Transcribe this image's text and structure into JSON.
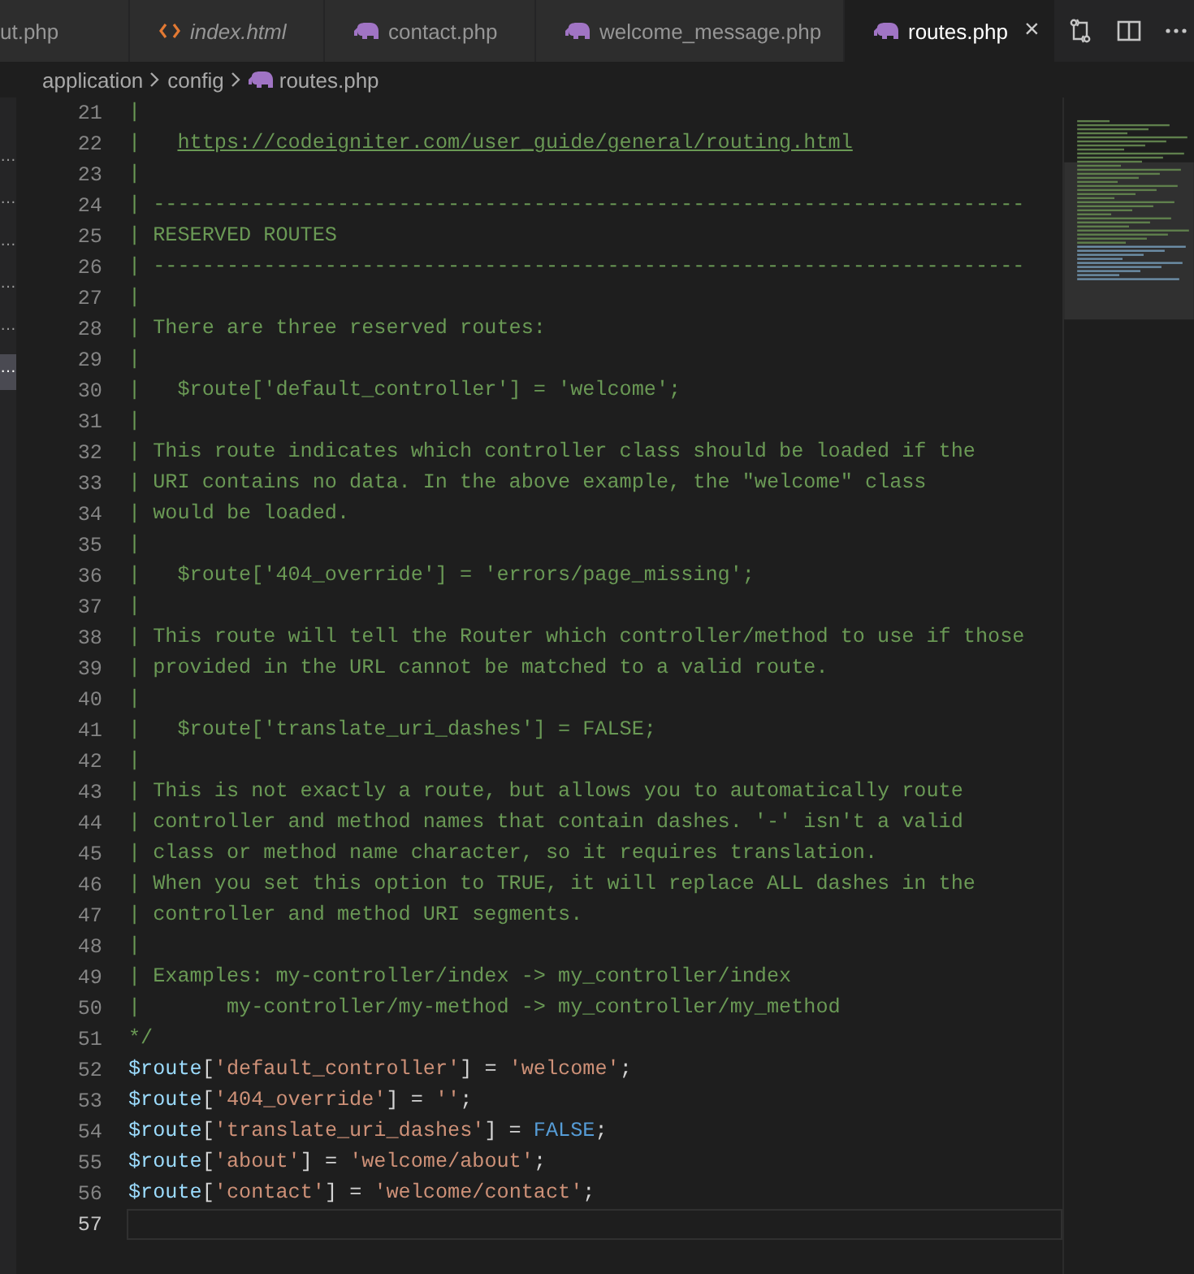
{
  "tabs": [
    {
      "label": "ut.php",
      "kind": "plain",
      "italic": false,
      "selected": false
    },
    {
      "label": "index.html",
      "kind": "html",
      "italic": true,
      "selected": false
    },
    {
      "label": "contact.php",
      "kind": "php",
      "italic": false,
      "selected": false
    },
    {
      "label": "welcome_message.php",
      "kind": "php",
      "italic": false,
      "selected": false
    },
    {
      "label": "routes.php",
      "kind": "php",
      "italic": false,
      "selected": true
    }
  ],
  "close_glyph": "×",
  "breadcrumb": [
    {
      "label": "application",
      "kind": "folder"
    },
    {
      "label": "config",
      "kind": "folder"
    },
    {
      "label": "routes.php",
      "kind": "php"
    }
  ],
  "sidebar_fragments": [
    {
      "text": "…",
      "selected": false
    },
    {
      "text": "…",
      "selected": false
    },
    {
      "text": "…",
      "selected": false
    },
    {
      "text": "…",
      "selected": false
    },
    {
      "text": "…",
      "selected": false
    },
    {
      "text": "…",
      "selected": true
    }
  ],
  "lines": [
    {
      "number": "21",
      "current": false,
      "tokens": [
        {
          "kind": "comment",
          "text": "|"
        }
      ]
    },
    {
      "number": "22",
      "current": false,
      "tokens": [
        {
          "kind": "comment",
          "text": "|   "
        },
        {
          "kind": "link",
          "text": "https://codeigniter.com/user_guide/general/routing.html"
        }
      ]
    },
    {
      "number": "23",
      "current": false,
      "tokens": [
        {
          "kind": "comment",
          "text": "|"
        }
      ]
    },
    {
      "number": "24",
      "current": false,
      "tokens": [
        {
          "kind": "comment",
          "text": "| -----------------------------------------------------------------------"
        }
      ]
    },
    {
      "number": "25",
      "current": false,
      "tokens": [
        {
          "kind": "comment",
          "text": "| RESERVED ROUTES"
        }
      ]
    },
    {
      "number": "26",
      "current": false,
      "tokens": [
        {
          "kind": "comment",
          "text": "| -----------------------------------------------------------------------"
        }
      ]
    },
    {
      "number": "27",
      "current": false,
      "tokens": [
        {
          "kind": "comment",
          "text": "|"
        }
      ]
    },
    {
      "number": "28",
      "current": false,
      "tokens": [
        {
          "kind": "comment",
          "text": "| There are three reserved routes:"
        }
      ]
    },
    {
      "number": "29",
      "current": false,
      "tokens": [
        {
          "kind": "comment",
          "text": "|"
        }
      ]
    },
    {
      "number": "30",
      "current": false,
      "tokens": [
        {
          "kind": "comment",
          "text": "|   $route['default_controller'] = 'welcome';"
        }
      ]
    },
    {
      "number": "31",
      "current": false,
      "tokens": [
        {
          "kind": "comment",
          "text": "|"
        }
      ]
    },
    {
      "number": "32",
      "current": false,
      "tokens": [
        {
          "kind": "comment",
          "text": "| This route indicates which controller class should be loaded if the"
        }
      ]
    },
    {
      "number": "33",
      "current": false,
      "tokens": [
        {
          "kind": "comment",
          "text": "| URI contains no data. In the above example, the \"welcome\" class"
        }
      ]
    },
    {
      "number": "34",
      "current": false,
      "tokens": [
        {
          "kind": "comment",
          "text": "| would be loaded."
        }
      ]
    },
    {
      "number": "35",
      "current": false,
      "tokens": [
        {
          "kind": "comment",
          "text": "|"
        }
      ]
    },
    {
      "number": "36",
      "current": false,
      "tokens": [
        {
          "kind": "comment",
          "text": "|   $route['404_override'] = 'errors/page_missing';"
        }
      ]
    },
    {
      "number": "37",
      "current": false,
      "tokens": [
        {
          "kind": "comment",
          "text": "|"
        }
      ]
    },
    {
      "number": "38",
      "current": false,
      "tokens": [
        {
          "kind": "comment",
          "text": "| This route will tell the Router which controller/method to use if those"
        }
      ]
    },
    {
      "number": "39",
      "current": false,
      "tokens": [
        {
          "kind": "comment",
          "text": "| provided in the URL cannot be matched to a valid route."
        }
      ]
    },
    {
      "number": "40",
      "current": false,
      "tokens": [
        {
          "kind": "comment",
          "text": "|"
        }
      ]
    },
    {
      "number": "41",
      "current": false,
      "tokens": [
        {
          "kind": "comment",
          "text": "|   $route['translate_uri_dashes'] = FALSE;"
        }
      ]
    },
    {
      "number": "42",
      "current": false,
      "tokens": [
        {
          "kind": "comment",
          "text": "|"
        }
      ]
    },
    {
      "number": "43",
      "current": false,
      "tokens": [
        {
          "kind": "comment",
          "text": "| This is not exactly a route, but allows you to automatically route"
        }
      ]
    },
    {
      "number": "44",
      "current": false,
      "tokens": [
        {
          "kind": "comment",
          "text": "| controller and method names that contain dashes. '-' isn't a valid"
        }
      ]
    },
    {
      "number": "45",
      "current": false,
      "tokens": [
        {
          "kind": "comment",
          "text": "| class or method name character, so it requires translation."
        }
      ]
    },
    {
      "number": "46",
      "current": false,
      "tokens": [
        {
          "kind": "comment",
          "text": "| When you set this option to TRUE, it will replace ALL dashes in the"
        }
      ]
    },
    {
      "number": "47",
      "current": false,
      "tokens": [
        {
          "kind": "comment",
          "text": "| controller and method URI segments."
        }
      ]
    },
    {
      "number": "48",
      "current": false,
      "tokens": [
        {
          "kind": "comment",
          "text": "|"
        }
      ]
    },
    {
      "number": "49",
      "current": false,
      "tokens": [
        {
          "kind": "comment",
          "text": "| Examples: my-controller/index -> my_controller/index"
        }
      ]
    },
    {
      "number": "50",
      "current": false,
      "tokens": [
        {
          "kind": "comment",
          "text": "|       my-controller/my-method -> my_controller/my_method"
        }
      ]
    },
    {
      "number": "51",
      "current": false,
      "tokens": [
        {
          "kind": "comment",
          "text": "*/"
        }
      ]
    },
    {
      "number": "52",
      "current": false,
      "tokens": [
        {
          "kind": "variable",
          "text": "$route"
        },
        {
          "kind": "punct",
          "text": "["
        },
        {
          "kind": "string",
          "text": "'default_controller'"
        },
        {
          "kind": "punct",
          "text": "] = "
        },
        {
          "kind": "string",
          "text": "'welcome'"
        },
        {
          "kind": "punct",
          "text": ";"
        }
      ]
    },
    {
      "number": "53",
      "current": false,
      "tokens": [
        {
          "kind": "variable",
          "text": "$route"
        },
        {
          "kind": "punct",
          "text": "["
        },
        {
          "kind": "string",
          "text": "'404_override'"
        },
        {
          "kind": "punct",
          "text": "] = "
        },
        {
          "kind": "string",
          "text": "''"
        },
        {
          "kind": "punct",
          "text": ";"
        }
      ]
    },
    {
      "number": "54",
      "current": false,
      "tokens": [
        {
          "kind": "variable",
          "text": "$route"
        },
        {
          "kind": "punct",
          "text": "["
        },
        {
          "kind": "string",
          "text": "'translate_uri_dashes'"
        },
        {
          "kind": "punct",
          "text": "] = "
        },
        {
          "kind": "keyword",
          "text": "FALSE"
        },
        {
          "kind": "punct",
          "text": ";"
        }
      ]
    },
    {
      "number": "55",
      "current": false,
      "tokens": [
        {
          "kind": "variable",
          "text": "$route"
        },
        {
          "kind": "punct",
          "text": "["
        },
        {
          "kind": "string",
          "text": "'about'"
        },
        {
          "kind": "punct",
          "text": "] = "
        },
        {
          "kind": "string",
          "text": "'welcome/about'"
        },
        {
          "kind": "punct",
          "text": ";"
        }
      ]
    },
    {
      "number": "56",
      "current": false,
      "tokens": [
        {
          "kind": "variable",
          "text": "$route"
        },
        {
          "kind": "punct",
          "text": "["
        },
        {
          "kind": "string",
          "text": "'contact'"
        },
        {
          "kind": "punct",
          "text": "] = "
        },
        {
          "kind": "string",
          "text": "'welcome/contact'"
        },
        {
          "kind": "punct",
          "text": ";"
        }
      ]
    },
    {
      "number": "57",
      "current": true
    }
  ]
}
